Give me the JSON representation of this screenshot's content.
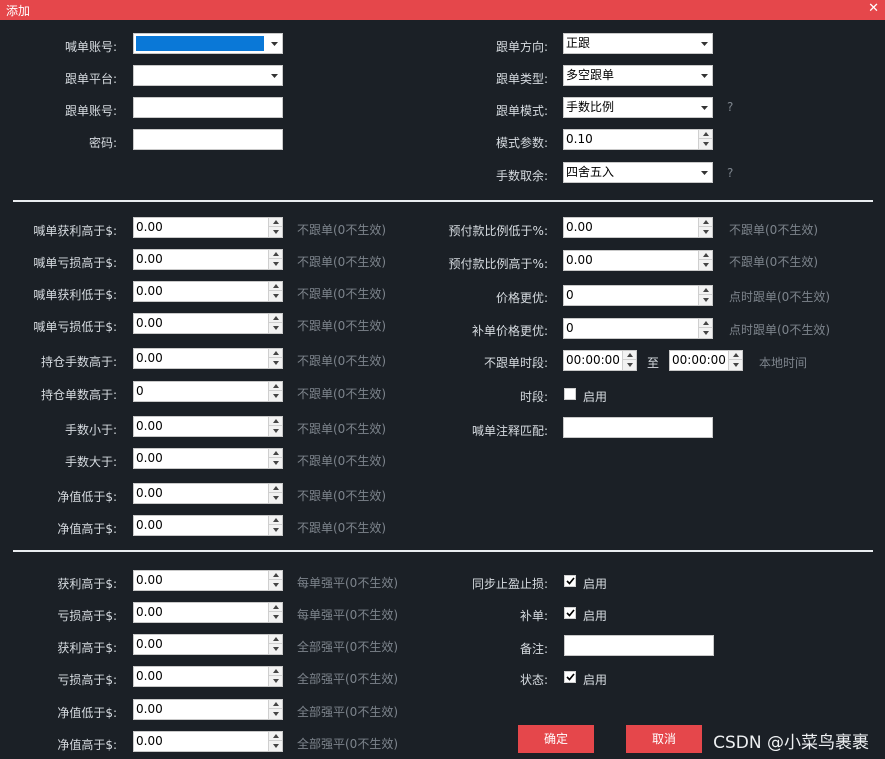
{
  "window": {
    "title": "添加",
    "close": "✕"
  },
  "top_left": {
    "caller_account_label": "喊单账号:",
    "follow_platform_label": "跟单平台:",
    "follow_account_label": "跟单账号:",
    "password_label": "密码:"
  },
  "top_right": {
    "direction_label": "跟单方向:",
    "direction_value": "正跟",
    "type_label": "跟单类型:",
    "type_value": "多空跟单",
    "mode_label": "跟单模式:",
    "mode_value": "手数比例",
    "param_label": "模式参数:",
    "param_value": "0.10",
    "rounding_label": "手数取余:",
    "rounding_value": "四舍五入",
    "help": "?"
  },
  "filters_left": [
    {
      "label": "喊单获利高于$:",
      "value": "0.00",
      "hint": "不跟单(0不生效)"
    },
    {
      "label": "喊单亏损高于$:",
      "value": "0.00",
      "hint": "不跟单(0不生效)"
    },
    {
      "label": "喊单获利低于$:",
      "value": "0.00",
      "hint": "不跟单(0不生效)"
    },
    {
      "label": "喊单亏损低于$:",
      "value": "0.00",
      "hint": "不跟单(0不生效)"
    },
    {
      "label": "持仓手数高于:",
      "value": "0.00",
      "hint": "不跟单(0不生效)"
    },
    {
      "label": "持仓单数高于:",
      "value": "0",
      "hint": "不跟单(0不生效)"
    },
    {
      "label": "手数小于:",
      "value": "0.00",
      "hint": "不跟单(0不生效)"
    },
    {
      "label": "手数大于:",
      "value": "0.00",
      "hint": "不跟单(0不生效)"
    },
    {
      "label": "净值低于$:",
      "value": "0.00",
      "hint": "不跟单(0不生效)"
    },
    {
      "label": "净值高于$:",
      "value": "0.00",
      "hint": "不跟单(0不生效)"
    }
  ],
  "filters_right": {
    "prepay_low_label": "预付款比例低于%:",
    "prepay_low_value": "0.00",
    "prepay_low_hint": "不跟单(0不生效)",
    "prepay_high_label": "预付款比例高于%:",
    "prepay_high_value": "0.00",
    "prepay_high_hint": "不跟单(0不生效)",
    "price_better_label": "价格更优:",
    "price_better_value": "0",
    "price_better_hint": "点时跟单(0不生效)",
    "refill_price_label": "补单价格更优:",
    "refill_price_value": "0",
    "refill_price_hint": "点时跟单(0不生效)",
    "no_follow_period_label": "不跟单时段:",
    "time_from": "00:00:00",
    "time_to_label": "至",
    "time_to": "00:00:00",
    "local_time": "本地时间",
    "period_label": "时段:",
    "period_enable": "启用",
    "comment_match_label": "喊单注释匹配:"
  },
  "close_left": [
    {
      "label": "获利高于$:",
      "value": "0.00",
      "hint": "每单强平(0不生效)"
    },
    {
      "label": "亏损高于$:",
      "value": "0.00",
      "hint": "每单强平(0不生效)"
    },
    {
      "label": "获利高于$:",
      "value": "0.00",
      "hint": "全部强平(0不生效)"
    },
    {
      "label": "亏损高于$:",
      "value": "0.00",
      "hint": "全部强平(0不生效)"
    },
    {
      "label": "净值低于$:",
      "value": "0.00",
      "hint": "全部强平(0不生效)"
    },
    {
      "label": "净值高于$:",
      "value": "0.00",
      "hint": "全部强平(0不生效)"
    }
  ],
  "close_right": {
    "sync_sltp_label": "同步止盈止损:",
    "sync_sltp_enable": "启用",
    "refill_label": "补单:",
    "refill_enable": "启用",
    "note_label": "备注:",
    "status_label": "状态:",
    "status_enable": "启用"
  },
  "buttons": {
    "ok": "确定",
    "cancel": "取消"
  },
  "watermark": "CSDN @小菜鸟裹裹",
  "colors": {
    "accent": "#e5474b",
    "background": "#1b2026",
    "selection": "#0a78d7"
  }
}
